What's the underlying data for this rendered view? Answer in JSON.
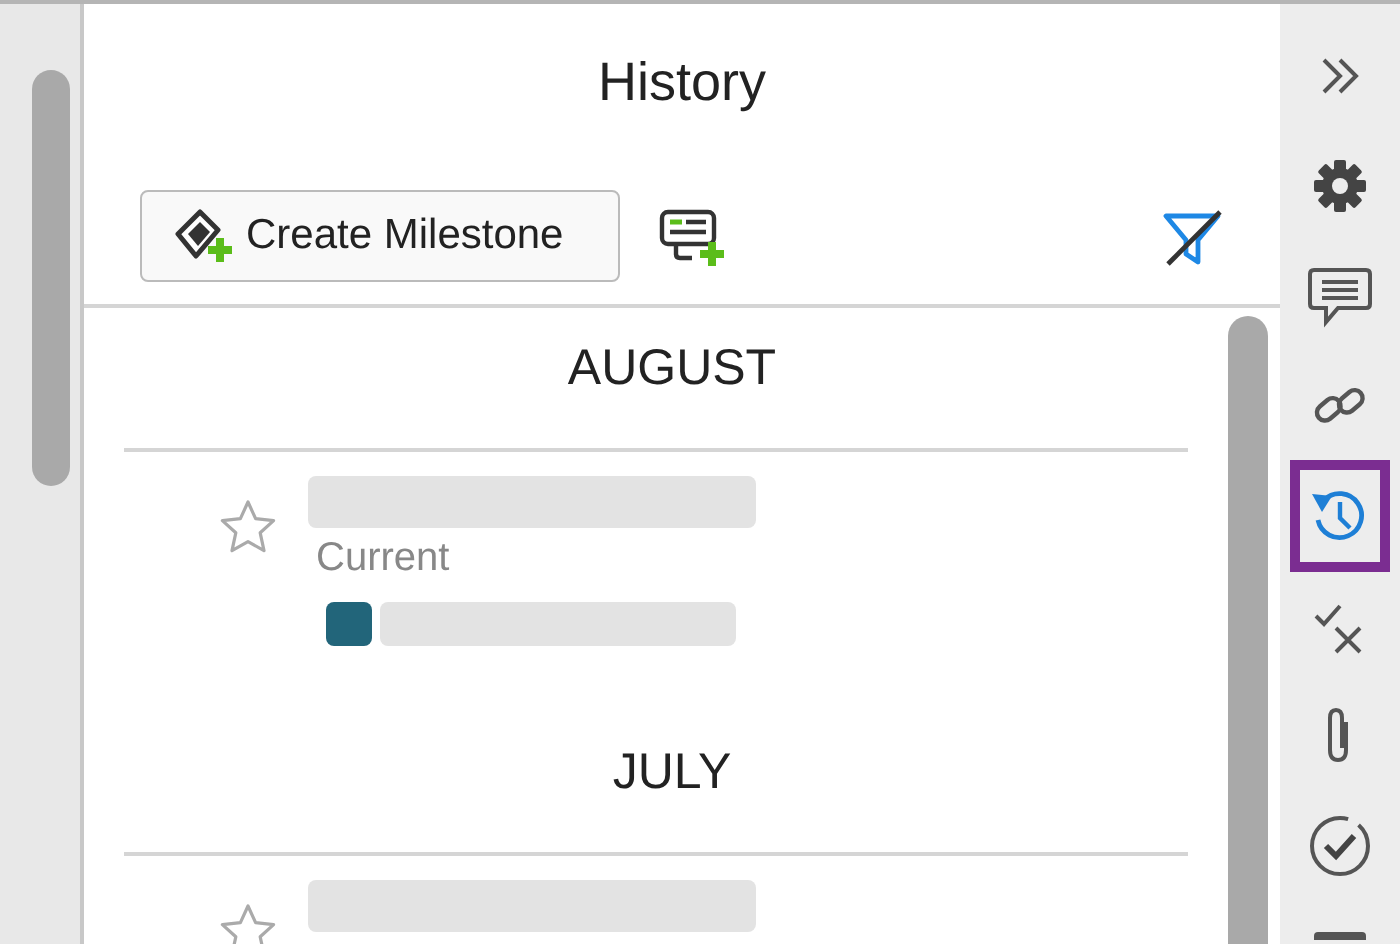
{
  "panel": {
    "title": "History"
  },
  "toolbar": {
    "create_button": "Create Milestone"
  },
  "groups": [
    {
      "month": "AUGUST",
      "entries": [
        {
          "starred": false,
          "status": "Current",
          "color": "#22657a"
        }
      ]
    },
    {
      "month": "JULY",
      "entries": [
        {
          "starred": false
        }
      ]
    }
  ],
  "sidebar": {
    "tools": [
      {
        "kind": "collapse",
        "selected": false
      },
      {
        "kind": "settings",
        "selected": false
      },
      {
        "kind": "comments",
        "selected": false
      },
      {
        "kind": "link",
        "selected": false
      },
      {
        "kind": "history",
        "selected": true
      },
      {
        "kind": "checkx",
        "selected": false
      },
      {
        "kind": "attach",
        "selected": false
      },
      {
        "kind": "check",
        "selected": false
      },
      {
        "kind": "partial",
        "selected": false
      }
    ]
  }
}
